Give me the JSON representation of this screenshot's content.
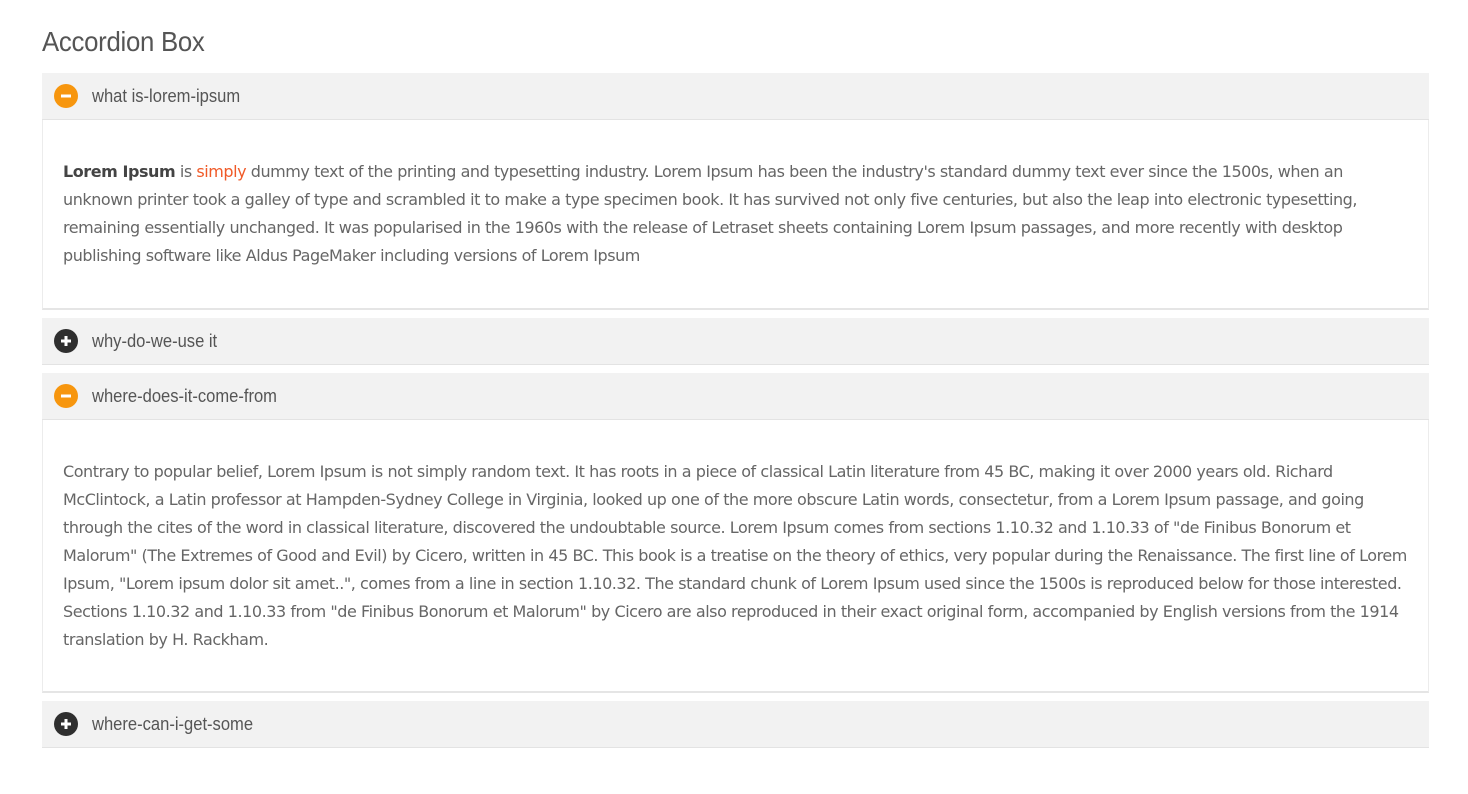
{
  "title": "Accordion Box",
  "colors": {
    "open_icon": "#f7960e",
    "closed_icon": "#2f2f2f",
    "link_accent": "#f05a28",
    "header_bg": "#f2f2f2"
  },
  "accordion": [
    {
      "label": "what is-lorem-ipsum",
      "state": "expanded",
      "icon": "minus-circle-icon",
      "body": {
        "strong": "Lorem Ipsum",
        "pre": " is ",
        "accent": "simply",
        "rest": " dummy text of the printing and typesetting industry. Lorem Ipsum has been the industry's standard dummy text ever since the 1500s, when an unknown printer took a galley of type and scrambled it to make a type specimen book. It has survived not only five centuries, but also the leap into electronic typesetting, remaining essentially unchanged. It was popularised in the 1960s with the release of Letraset sheets containing Lorem Ipsum passages, and more recently with desktop publishing software like Aldus PageMaker including versions of Lorem Ipsum"
      }
    },
    {
      "label": "why-do-we-use it",
      "state": "collapsed",
      "icon": "plus-circle-icon"
    },
    {
      "label": "where-does-it-come-from",
      "state": "expanded",
      "icon": "minus-circle-icon",
      "body": {
        "text": "Contrary to popular belief, Lorem Ipsum is not simply random text. It has roots in a piece of classical Latin literature from 45 BC, making it over 2000 years old. Richard McClintock, a Latin professor at Hampden-Sydney College in Virginia, looked up one of the more obscure Latin words, consectetur, from a Lorem Ipsum passage, and going through the cites of the word in classical literature, discovered the undoubtable source. Lorem Ipsum comes from sections 1.10.32 and 1.10.33 of \"de Finibus Bonorum et Malorum\" (The Extremes of Good and Evil) by Cicero, written in 45 BC. This book is a treatise on the theory of ethics, very popular during the Renaissance. The first line of Lorem Ipsum, \"Lorem ipsum dolor sit amet..\", comes from a line in section 1.10.32. The standard chunk of Lorem Ipsum used since the 1500s is reproduced below for those interested. Sections 1.10.32 and 1.10.33 from \"de Finibus Bonorum et Malorum\" by Cicero are also reproduced in their exact original form, accompanied by English versions from the 1914 translation by H. Rackham."
      }
    },
    {
      "label": "where-can-i-get-some",
      "state": "collapsed",
      "icon": "plus-circle-icon"
    }
  ]
}
